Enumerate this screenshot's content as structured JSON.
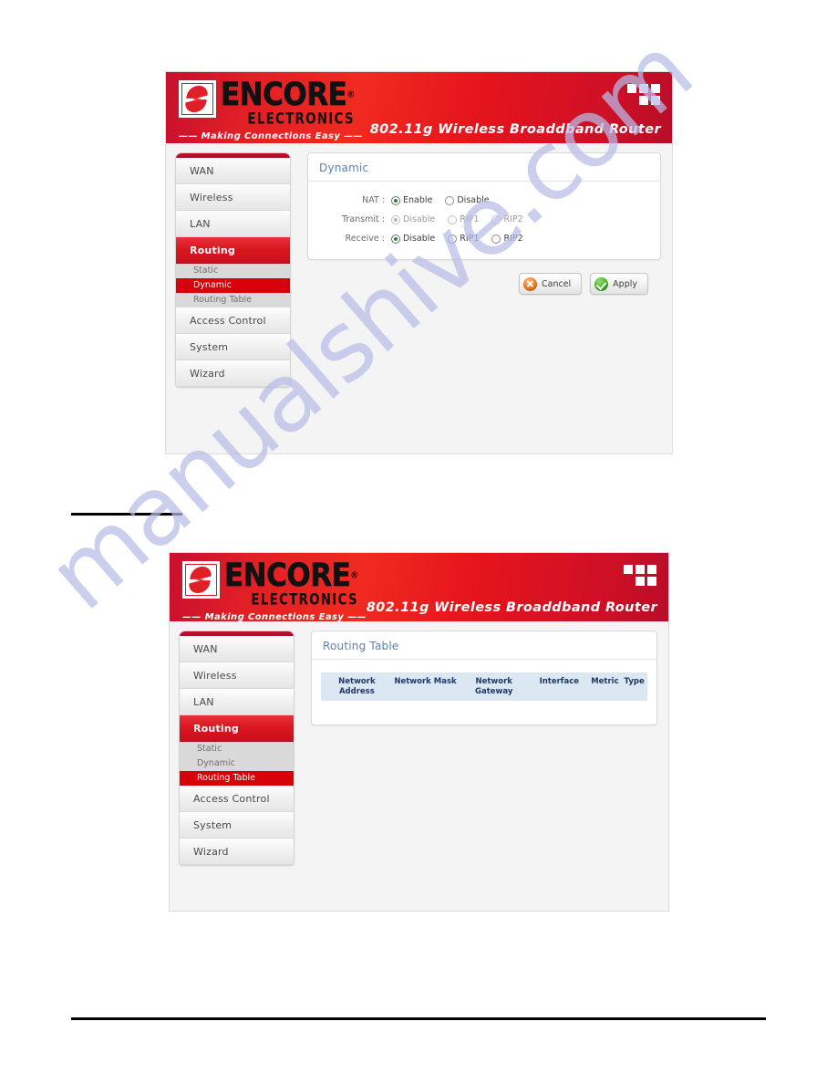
{
  "watermark": {
    "text": "manualshive.com"
  },
  "banner": {
    "logo_name": "ENCORE",
    "logo_reg": "®",
    "logo_sub": "ELECTRONICS",
    "tagline": "—— Making Connections Easy ——",
    "product_title": "802.11g Wireless Broaddband Router",
    "grid_icon": "grid-icon"
  },
  "sidebar": {
    "items": [
      {
        "label": "WAN",
        "active": false
      },
      {
        "label": "Wireless",
        "active": false
      },
      {
        "label": "LAN",
        "active": false
      },
      {
        "label": "Routing",
        "active": true
      },
      {
        "label": "Access Control",
        "active": false
      },
      {
        "label": "System",
        "active": false
      },
      {
        "label": "Wizard",
        "active": false
      }
    ],
    "subitems_screen1": [
      {
        "label": "Static",
        "active": false
      },
      {
        "label": "Dynamic",
        "active": true
      },
      {
        "label": "Routing Table",
        "active": false
      }
    ],
    "subitems_screen2": [
      {
        "label": "Static",
        "active": false
      },
      {
        "label": "Dynamic",
        "active": false
      },
      {
        "label": "Routing Table",
        "active": true
      }
    ]
  },
  "screen1": {
    "card_title": "Dynamic",
    "rows": [
      {
        "label": "NAT :",
        "dim": false,
        "options": [
          {
            "label": "Enable",
            "selected": true
          },
          {
            "label": "Disable",
            "selected": false
          }
        ]
      },
      {
        "label": "Transmit :",
        "dim": true,
        "options": [
          {
            "label": "Disable",
            "selected": true
          },
          {
            "label": "RIP1",
            "selected": false
          },
          {
            "label": "RIP2",
            "selected": false
          }
        ]
      },
      {
        "label": "Receive :",
        "dim": false,
        "options": [
          {
            "label": "Disable",
            "selected": true
          },
          {
            "label": "RIP1",
            "selected": false
          },
          {
            "label": "RIP2",
            "selected": false
          }
        ]
      }
    ],
    "buttons": {
      "cancel_label": "Cancel",
      "apply_label": "Apply"
    }
  },
  "screen2": {
    "card_title": "Routing Table",
    "table_headers": [
      "Network Address",
      "Network Mask",
      "Network Gateway",
      "Interface",
      "Metric",
      "Type"
    ],
    "table_rows": []
  },
  "colors": {
    "brand_red": "#d9161f",
    "accent_blue": "#5b7fb5",
    "table_header_bg": "#dce7f4",
    "table_header_text": "#1f3864",
    "watermark": "#b9bce8"
  }
}
